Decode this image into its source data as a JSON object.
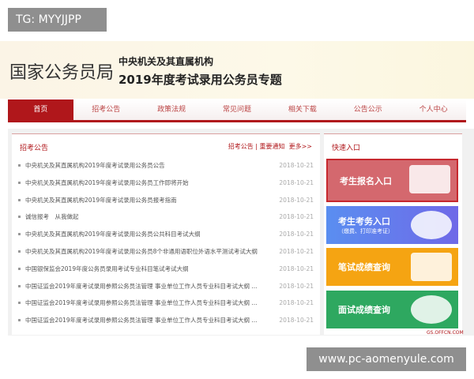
{
  "overlay_badge": "TG: MYYJJPP",
  "watermark": "www.pc-aomenyule.com",
  "corner_mark": "GS.OFFCN.COM",
  "header": {
    "logo": "国家公务员局",
    "subtitle": "中央机关及其直属机构",
    "title": "2019年度考试录用公务员专题"
  },
  "nav": [
    "首页",
    "招考公告",
    "政策法规",
    "常见问题",
    "相关下载",
    "公告公示",
    "个人中心"
  ],
  "notices": {
    "title": "招考公告",
    "links": "招考公告 | 重要通知",
    "more": "更多>>",
    "items": [
      {
        "title": "中央机关及其直属机构2019年度考试录用公务员公告",
        "date": "2018-10-21"
      },
      {
        "title": "中央机关及其直属机构2019年度考试录用公务员工作即将开始",
        "date": "2018-10-21"
      },
      {
        "title": "中央机关及其直属机构2019年度考试录用公务员报考指南",
        "date": "2018-10-21"
      },
      {
        "title": "诚信报考　从我做起",
        "date": "2018-10-21"
      },
      {
        "title": "中央机关及其直属机构2019年度考试录用公务员公共科目考试大纲",
        "date": "2018-10-21"
      },
      {
        "title": "中央机关及其直属机构2019年度考试录用公务员8个非通用语职位外语水平测试考试大纲",
        "date": "2018-10-21"
      },
      {
        "title": "中国银保监会2019年度公务员录用考试专业科目笔试考试大纲",
        "date": "2018-10-21"
      },
      {
        "title": "中国证监会2019年度考试录用参照公务员法管理 事业单位工作人员专业科目考试大纲 ...",
        "date": "2018-10-21"
      },
      {
        "title": "中国证监会2019年度考试录用参照公务员法管理 事业单位工作人员专业科目考试大纲 ...",
        "date": "2018-10-21"
      },
      {
        "title": "中国证监会2019年度考试录用参照公务员法管理 事业单位工作人员专业科目考试大纲 ...",
        "date": "2018-10-21"
      }
    ]
  },
  "quick": {
    "title": "快速入口",
    "cards": [
      {
        "label": "考生报名入口",
        "note": ""
      },
      {
        "label": "考生考务入口",
        "note": "（缴费、打印准考证）"
      },
      {
        "label": "笔试成绩查询",
        "note": ""
      },
      {
        "label": "面试成绩查询",
        "note": ""
      }
    ]
  },
  "colors": {
    "brand": "#b0171b",
    "card1": "#d4686e",
    "card2": "#6a7ee8",
    "card3": "#f5a412",
    "card4": "#2ea860"
  }
}
